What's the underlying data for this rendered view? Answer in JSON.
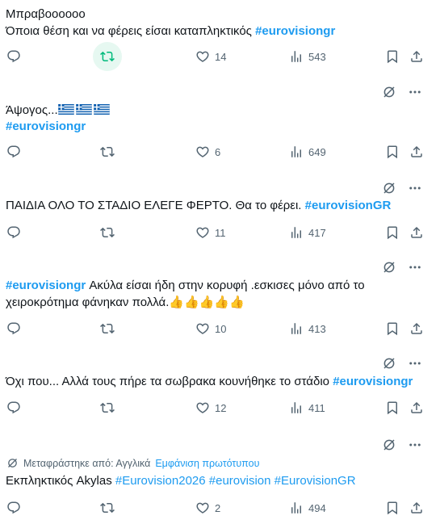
{
  "posts": [
    {
      "line1": "Μπραβοοοοοο",
      "line2_text": "Όποια θέση και να φέρεις είσαι καταπληκτικός ",
      "line2_tag": "#eurovisiongr",
      "reply": "",
      "retweet": "",
      "like": "14",
      "views": "543"
    },
    {
      "text": "Άψογος...",
      "flags": [
        "greek-flag",
        "greek-flag",
        "greek-flag"
      ],
      "tag": "#eurovisiongr",
      "reply": "",
      "retweet": "",
      "like": "6",
      "views": "649"
    },
    {
      "text": "ΠΑΙΔΙΑ ΟΛΟ ΤΟ ΣΤΑΔΙΟ ΕΛΕΓΕ ΦΕΡΤΟ. Θα το φέρει. ",
      "tag": "#eurovisionGR",
      "reply": "",
      "retweet": "",
      "like": "11",
      "views": "417"
    },
    {
      "tag": "#eurovisiongr",
      "text1": " Ακύλα είσαι ήδη στην κορυφή .εσκισες μόνο από το",
      "text2": "χειροκρότημα φάνηκαν πολλά.",
      "emoji": "👍👍👍👍👍",
      "reply": "",
      "retweet": "",
      "like": "10",
      "views": "413"
    },
    {
      "text": "Όχι που... Αλλά τους πήρε τα σωβρακα κουνήθηκε το στάδιο ",
      "tag": "#eurovisiongr",
      "reply": "",
      "retweet": "",
      "like": "12",
      "views": "411"
    },
    {
      "translated_label": "Μεταφράστηκε από: Αγγλικά",
      "translated_link": "Εμφάνιση πρωτότυπου",
      "text": "Εκπληκτικός Akylas ",
      "tags": [
        "#Eurovision2026",
        "#eurovision",
        "#EurovisionGR"
      ],
      "reply": "",
      "retweet": "",
      "like": "2",
      "views": "494"
    }
  ],
  "colors": {
    "accent": "#1d9bf0",
    "retweet_active": "#00ba7c",
    "muted": "#536471"
  }
}
